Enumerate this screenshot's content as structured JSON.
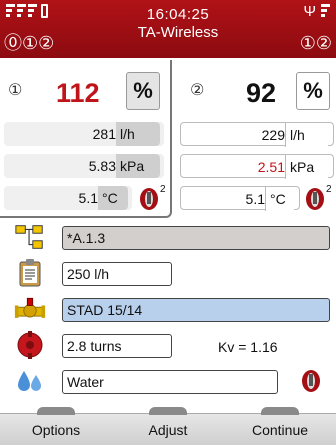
{
  "status": {
    "time": "16:04:25",
    "subtitle": "TA-Wireless",
    "probe_left_1": "①",
    "probe_left_2": "②",
    "probe_right_1": "①",
    "probe_right_2": "②"
  },
  "probe1": {
    "index": "①",
    "main_value": "112",
    "main_unit": "%",
    "flow_value": "281",
    "flow_unit": "l/h",
    "pressure_value": "5.83",
    "pressure_unit": "kPa",
    "temp_value": "5.1",
    "temp_unit": "°C",
    "temp_badge": "2"
  },
  "probe2": {
    "index": "②",
    "main_value": "92",
    "main_unit": "%",
    "flow_value": "229",
    "flow_unit": "l/h",
    "pressure_value": "2.51",
    "pressure_unit": "kPa",
    "temp_value": "5.1",
    "temp_unit": "°C",
    "temp_badge": "2"
  },
  "config": {
    "circuit": "*A.1.3",
    "design_flow": "250 l/h",
    "valve": "STAD 15/14",
    "setting": "2.8 turns",
    "kv": "Kv = 1.16",
    "medium": "Water"
  },
  "softkeys": {
    "left": "Options",
    "middle": "Adjust",
    "right": "Continue"
  },
  "colors": {
    "header": "#a30f14",
    "value_red": "#c0141b",
    "pressure_red": "#c0141b",
    "valve_field": "#b8d0ec",
    "circuit_field": "#d3cfcc"
  }
}
